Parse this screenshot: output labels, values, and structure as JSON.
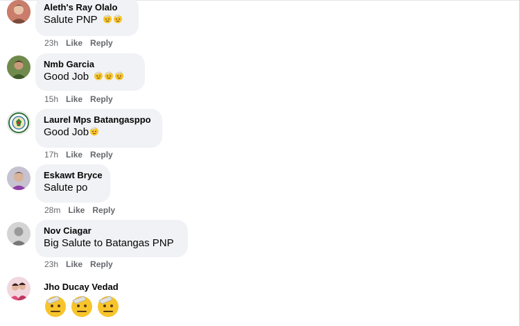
{
  "comments": [
    {
      "author": "Aleth's Ray Olalo",
      "text": "Salute PNP",
      "emoji_count": 2,
      "time": "23h",
      "like": "Like",
      "reply": "Reply"
    },
    {
      "author": "Nmb Garcia",
      "text": "Good Job",
      "emoji_count": 3,
      "time": "15h",
      "like": "Like",
      "reply": "Reply"
    },
    {
      "author": "Laurel Mps Batangasppo",
      "text": "Good Job",
      "emoji_count": 1,
      "time": "17h",
      "like": "Like",
      "reply": "Reply"
    },
    {
      "author": "Eskawt Bryce",
      "text": "Salute po",
      "emoji_count": 0,
      "time": "28m",
      "like": "Like",
      "reply": "Reply"
    },
    {
      "author": "Nov Ciagar",
      "text": "Big Salute to Batangas PNP",
      "emoji_count": 0,
      "time": "23h",
      "like": "Like",
      "reply": "Reply"
    },
    {
      "author": "Jho Ducay Vedad",
      "text": "",
      "emoji_count": 3,
      "time": "",
      "like": "",
      "reply": ""
    }
  ],
  "icons": {
    "salute_emoji": "saluting-face-icon"
  },
  "colors": {
    "bubble": "#f0f2f5",
    "meta": "#65676b",
    "text": "#050505",
    "emoji": "#f7c52b"
  }
}
